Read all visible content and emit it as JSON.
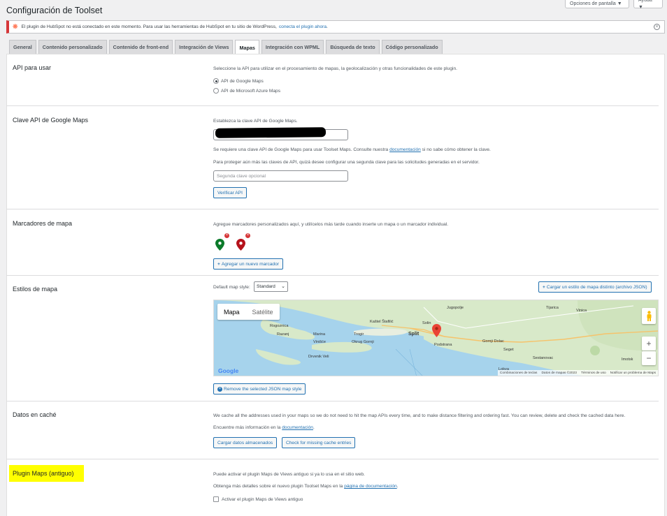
{
  "screen_options": {
    "options_label": "Opciones de pantalla ▼",
    "help_label": "Ayuda ▼"
  },
  "page_title": "Configuración de Toolset",
  "notice": {
    "text": "El plugin de HubSpot no está conectado en este momento. Para usar las herramientas de HubSpot en tu sitio de WordPress,",
    "link": "conecta el plugin ahora",
    "link_suffix": "."
  },
  "tabs": [
    "General",
    "Contenido personalizado",
    "Contenido de front-end",
    "Integración de Views",
    "Mapas",
    "Integración con WPML",
    "Búsqueda de texto",
    "Código personalizado"
  ],
  "active_tab": "Mapas",
  "api_section": {
    "title": "API para usar",
    "desc": "Seleccione la API para utilizar en el procesamiento de mapas, la geolocalización y otras funcionalidades de este plugin.",
    "options": [
      "API de Google Maps",
      "API de Microsoft Azure Maps"
    ],
    "selected": "API de Google Maps"
  },
  "key_section": {
    "title": "Clave API de Google Maps",
    "desc": "Establezca la clave API de Google Maps.",
    "note1_prefix": "Se requiere una clave API de Google Maps para usar Toolset Maps. Consulte nuestra",
    "note1_link": "documentación",
    "note1_suffix": "si no sabe cómo obtener la clave.",
    "note2": "Para proteger aún más las claves de API, quizá desee configurar una segunda clave para las solicitudes generadas en el servidor.",
    "second_key_placeholder": "Segunda clave opcional",
    "verify_button": "Verificar API"
  },
  "markers_section": {
    "title": "Marcadores de mapa",
    "desc": "Agregue marcadores personalizados aquí, y utilícelos más tarde cuando inserte un mapa o un marcador individual.",
    "marker_colors": [
      "#0b7a2a",
      "#b5121b"
    ],
    "add_button": "Agregar un nuevo marcador"
  },
  "styles_section": {
    "title": "Estilos de mapa",
    "default_label": "Default map style:",
    "default_value": "Standard",
    "load_button": "Cargar un estilo de mapa distinto (archivo JSON)",
    "remove_button": "Remove the selected JSON map style",
    "map": {
      "type_map": "Mapa",
      "type_satellite": "Satélite",
      "labels": [
        "Tijarica",
        "Vinica",
        "Jugopolje",
        "Kaštel Štafilić",
        "Solin",
        "Rogoznica",
        "Marina",
        "Trogir",
        "Split",
        "Podstrana",
        "Razanj",
        "Vinišće",
        "Okrug Gornji",
        "Gornji Dolac",
        "Seget",
        "Sestanovac",
        "Drvenik Veli",
        "Lokva",
        "Imotsk"
      ],
      "attribution": [
        "Combinaciones de teclas",
        "Datos de mapas ©2023",
        "Términos de uso",
        "Notificar un problema de Maps"
      ],
      "google": "Google"
    }
  },
  "cache_section": {
    "title": "Datos en caché",
    "desc": "We cache all the addresses used in your maps so we do not need to hit the map APIs every time, and to make distance filtering and ordering fast. You can review, delete and check the cached data here.",
    "more_prefix": "Encuentre más información en la",
    "more_link": "documentación",
    "more_suffix": ".",
    "load_button": "Cargar datos almacenados",
    "check_button": "Check for missing cache entries"
  },
  "legacy_section": {
    "title": "Plugin Maps (antiguo)",
    "desc1": "Puede activar el plugin Maps de Views antiguo si ya lo usa en el sitio web.",
    "desc2_prefix": "Obtenga más detalles sobre el nuevo plugin Toolset Maps en la",
    "desc2_link": "página de documentación",
    "desc2_suffix": ".",
    "checkbox_label": "Activar el plugin Maps de Views antiguo",
    "highlight_color": "#ffff00"
  }
}
